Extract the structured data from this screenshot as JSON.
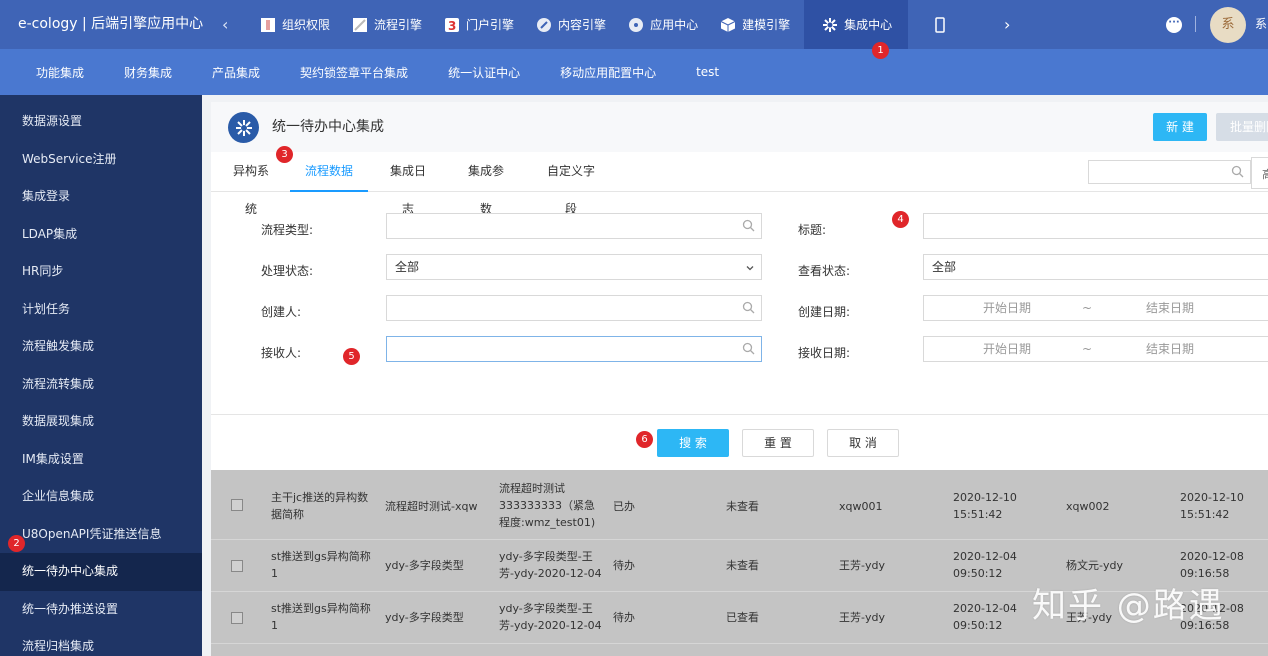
{
  "header": {
    "brand": "e-cology | 后端引擎应用中心",
    "nav": [
      {
        "label": "组织权限",
        "icon": "org-icon"
      },
      {
        "label": "流程引擎",
        "icon": "workflow-icon"
      },
      {
        "label": "门户引擎",
        "icon": "portal-icon"
      },
      {
        "label": "内容引擎",
        "icon": "content-icon"
      },
      {
        "label": "应用中心",
        "icon": "app-icon"
      },
      {
        "label": "建模引擎",
        "icon": "model-icon"
      },
      {
        "label": "集成中心",
        "icon": "integration-icon",
        "active": true
      }
    ],
    "avatar_text": "系",
    "user_text": "系"
  },
  "subnav": [
    "功能集成",
    "财务集成",
    "产品集成",
    "契约锁签章平台集成",
    "统一认证中心",
    "移动应用配置中心",
    "test"
  ],
  "sidebar": {
    "items": [
      {
        "label": "数据源设置"
      },
      {
        "label": "WebService注册"
      },
      {
        "label": "集成登录"
      },
      {
        "label": "LDAP集成"
      },
      {
        "label": "HR同步"
      },
      {
        "label": "计划任务"
      },
      {
        "label": "流程触发集成"
      },
      {
        "label": "流程流转集成"
      },
      {
        "label": "数据展现集成"
      },
      {
        "label": "IM集成设置"
      },
      {
        "label": "企业信息集成"
      },
      {
        "label": "U8OpenAPI凭证推送信息"
      },
      {
        "label": "统一待办中心集成",
        "active": true
      },
      {
        "label": "统一待办推送设置"
      },
      {
        "label": "流程归档集成"
      }
    ]
  },
  "panel": {
    "title": "统一待办中心集成",
    "new_button": "新 建",
    "batch_delete_button": "批量删除",
    "tabs": [
      "异构系统",
      "流程数据",
      "集成日志",
      "集成参数",
      "自定义字段"
    ],
    "tab_advanced": "高"
  },
  "form": {
    "workflow_type_label": "流程类型:",
    "title_label": "标题:",
    "status_label": "处理状态:",
    "status_value": "全部",
    "view_status_label": "查看状态:",
    "view_status_value": "全部",
    "creator_label": "创建人:",
    "create_date_label": "创建日期:",
    "receiver_label": "接收人:",
    "receive_date_label": "接收日期:",
    "start_date_placeholder": "开始日期",
    "end_date_placeholder": "结束日期",
    "range_separator": "~"
  },
  "buttons": {
    "search": "搜 索",
    "reset": "重 置",
    "cancel": "取 消"
  },
  "rows": [
    {
      "c1": "主干jc推送的异构数据简称",
      "c2": "流程超时测试-xqw",
      "c3": "流程超时测试 333333333（紧急程度:wmz_test01)",
      "c4": "已办",
      "c5": "未查看",
      "c6": "xqw001",
      "c7": "2020-12-10 15:51:42",
      "c8": "xqw002",
      "c9": "2020-12-10 15:51:42"
    },
    {
      "c1": "st推送到gs异构简称1",
      "c2": "ydy-多字段类型",
      "c3": "ydy-多字段类型-王芳-ydy-2020-12-04",
      "c4": "待办",
      "c5": "未查看",
      "c6": "王芳-ydy",
      "c7": "2020-12-04 09:50:12",
      "c8": "杨文元-ydy",
      "c9": "2020-12-08 09:16:58"
    },
    {
      "c1": "st推送到gs异构简称1",
      "c2": "ydy-多字段类型",
      "c3": "ydy-多字段类型-王芳-ydy-2020-12-04",
      "c4": "待办",
      "c5": "已查看",
      "c6": "王芳-ydy",
      "c7": "2020-12-04 09:50:12",
      "c8": "王芳-ydy",
      "c9": "2020-12-08 09:16:58"
    }
  ],
  "badges": [
    "1",
    "2",
    "3",
    "4",
    "5",
    "6"
  ],
  "watermark": "知乎 @路遇",
  "colors": {
    "topbar": "#3f64b6",
    "subnav": "#4a78d0",
    "sidebar": "#1f3566",
    "accent": "#2db7f5",
    "active_tab": "#1a9bff",
    "badge": "#e0262a"
  }
}
